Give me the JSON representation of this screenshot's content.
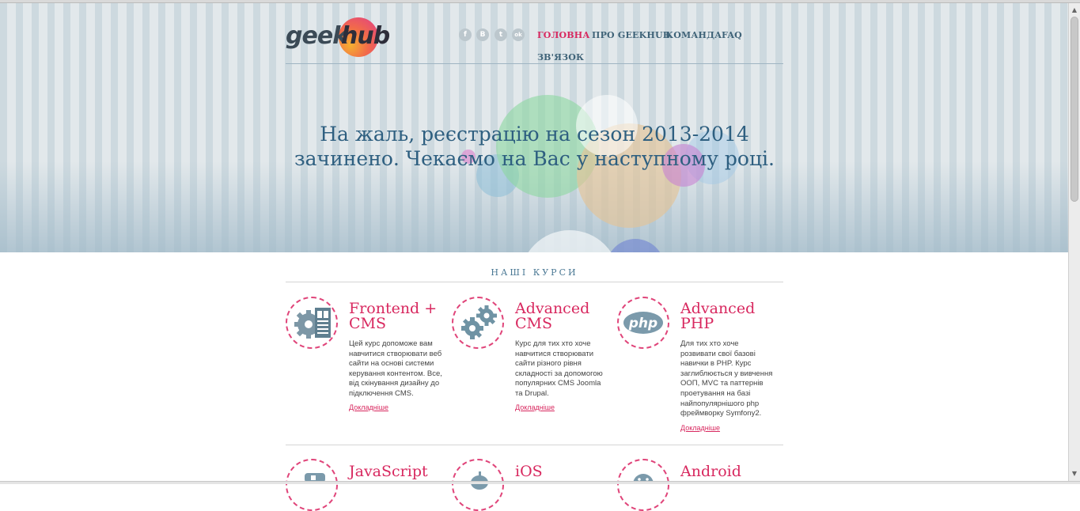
{
  "brand": {
    "logo_geek": "geek",
    "logo_hub": "hub"
  },
  "social": [
    {
      "icon": "facebook-icon",
      "glyph": "f"
    },
    {
      "icon": "vk-icon",
      "glyph": "В"
    },
    {
      "icon": "twitter-icon",
      "glyph": "t"
    },
    {
      "icon": "odnoklassniki-icon",
      "glyph": "ok"
    }
  ],
  "nav": {
    "home": "ГОЛОВНА",
    "about": "ПРО GEEKHUB",
    "team": "КОМАНДА",
    "faq": "FAQ",
    "contact": "ЗВ'ЯЗОК"
  },
  "hero": {
    "line1": "На жаль, реєстрацію на сезон 2013-2014",
    "line2": "зачинено. Чекаємо на Вас у наступному році."
  },
  "courses_section": {
    "title": "НАШІ КУРСИ",
    "more_label": "Докладніше",
    "row1": [
      {
        "title_line1": "Frontend +",
        "title_line2": "CMS",
        "description": "Цей курс допоможе вам навчитися створювати веб сайти на основі системи керування контентом. Все, від скінування дизайну до підключення CMS."
      },
      {
        "title_line1": "Advanced",
        "title_line2": "CMS",
        "description": "Курс для тих хто хоче навчитися створювати сайти різного рівня складності за допомогою популярних CMS Joomla та Drupal."
      },
      {
        "title_line1": "Advanced",
        "title_line2": "PHP",
        "icon_label": "php",
        "description": "Для тих хто хоче розвивати свої базові навички в PHP. Курс заглиблюється у вивчення ООП, MVC та паттернів проетування на базі найпопулярнішого php фреймворку Symfony2."
      }
    ],
    "row2": [
      {
        "title": "JavaScript"
      },
      {
        "title": "iOS"
      },
      {
        "title": "Android"
      }
    ]
  },
  "colors": {
    "accent": "#d8285f",
    "nav_text": "#3f6378",
    "hero_text": "#2e5f80"
  }
}
